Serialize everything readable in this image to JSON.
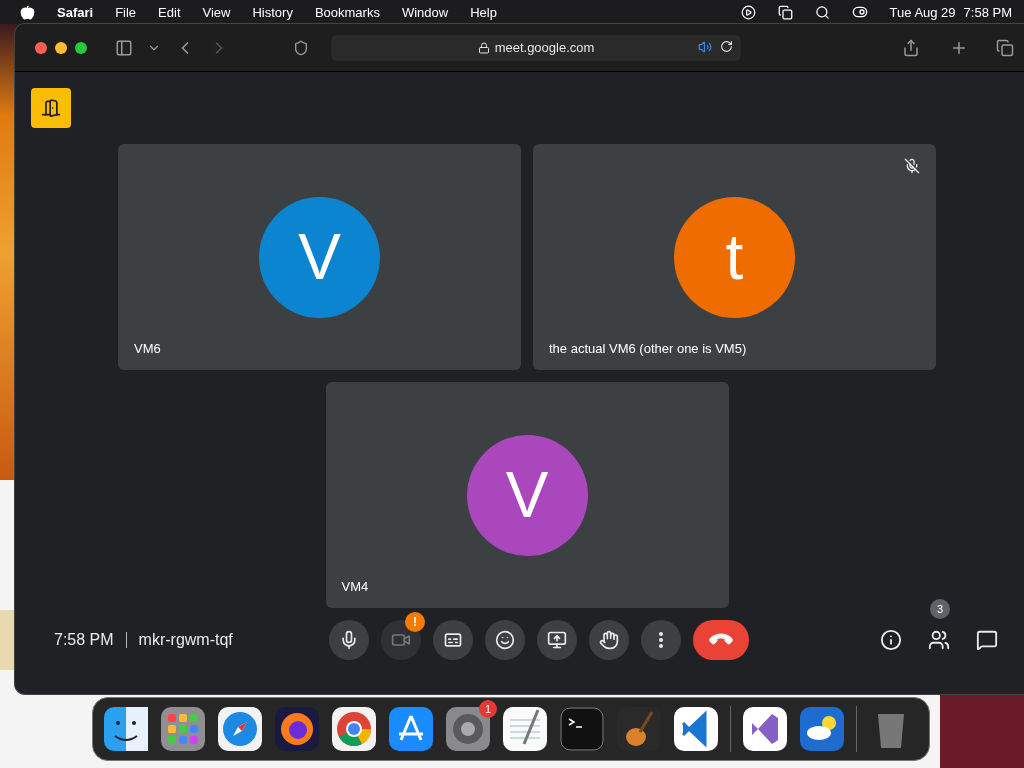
{
  "menu_bar": {
    "app": "Safari",
    "items": [
      "File",
      "Edit",
      "View",
      "History",
      "Bookmarks",
      "Window",
      "Help"
    ],
    "date": "Tue Aug 29",
    "time": "7:58 PM"
  },
  "browser": {
    "url": "meet.google.com"
  },
  "tiles": [
    {
      "name": "VM6",
      "initial": "V",
      "color": "#0c85d0",
      "muted": false
    },
    {
      "name": "the actual VM6 (other one is VM5)",
      "initial": "t",
      "color": "#ef6c00",
      "muted": true
    },
    {
      "name": "VM4",
      "initial": "V",
      "color": "#ab47bc",
      "muted": false
    }
  ],
  "call_bar": {
    "time": "7:58 PM",
    "meeting_code": "mkr-rgwm-tqf",
    "participant_count": "3",
    "controls": [
      {
        "kind": "mic",
        "disabled": false
      },
      {
        "kind": "camera",
        "disabled": true,
        "alert": "!"
      },
      {
        "kind": "captions",
        "disabled": false
      },
      {
        "kind": "emoji",
        "disabled": false
      },
      {
        "kind": "present",
        "disabled": false
      },
      {
        "kind": "hand",
        "disabled": false
      },
      {
        "kind": "more",
        "disabled": false
      },
      {
        "kind": "leave",
        "disabled": false
      }
    ]
  },
  "dock": {
    "apps": [
      {
        "kind": "finder"
      },
      {
        "kind": "launchpad"
      },
      {
        "kind": "safari"
      },
      {
        "kind": "firefox"
      },
      {
        "kind": "chrome"
      },
      {
        "kind": "appstore"
      },
      {
        "kind": "settings",
        "badge": "1"
      },
      {
        "kind": "textedit"
      },
      {
        "kind": "terminal"
      },
      {
        "kind": "garageband"
      },
      {
        "kind": "vscode"
      },
      {
        "kind": "separator"
      },
      {
        "kind": "visualstudio"
      },
      {
        "kind": "weather"
      },
      {
        "kind": "separator"
      },
      {
        "kind": "trash"
      }
    ]
  }
}
